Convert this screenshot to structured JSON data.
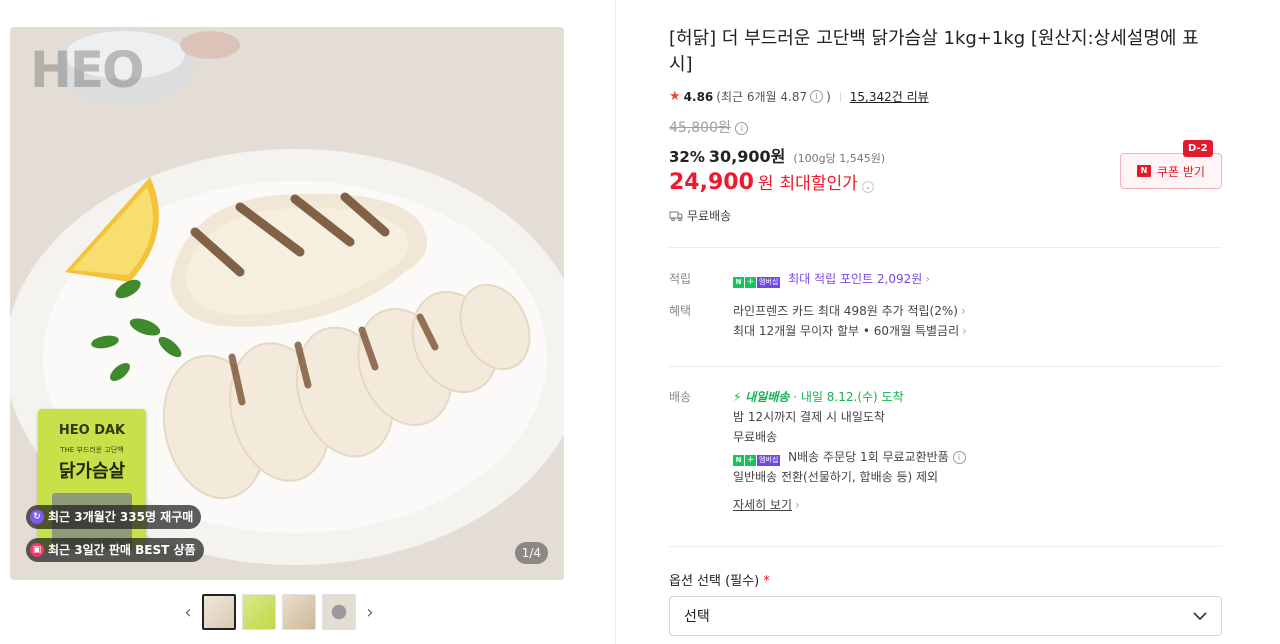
{
  "gallery": {
    "watermark": "HEO",
    "package": {
      "brand": "HEO DAK",
      "subtitle": "THE 부드러운 고단백",
      "name": "닭가슴살"
    },
    "badges": [
      {
        "icon": "repurchase-icon",
        "text": "최근 3개월간 335명 재구매",
        "color": "#7b5cf0"
      },
      {
        "icon": "gift-icon",
        "text": "최근 3일간 판매 BEST 상품",
        "color": "#f0386b"
      }
    ],
    "pager": "1/4",
    "thumbnails": [
      "썸네일 1",
      "썸네일 2",
      "썸네일 3",
      "썸네일 4"
    ]
  },
  "product": {
    "title": "[허닭] 더 부드러운 고단백 닭가슴살 1kg+1kg [원산지:상세설명에 표시]",
    "rating": "4.86",
    "recent_rating": "(최근 6개월 4.87",
    "recent_rating_close": ")",
    "reviews": "15,342건 리뷰",
    "original_price": "45,800원",
    "discount_pct": "32%",
    "sale_price": "30,900원",
    "unit_price": "(100g당 1,545원)",
    "max_price": "24,900",
    "max_won": "원",
    "max_label": "최대할인가",
    "shipping": "무료배송",
    "coupon_label": "쿠폰 받기",
    "coupon_dday": "D-2"
  },
  "points": {
    "label": "적립",
    "text": "최대 적립 포인트 2,092원"
  },
  "benefits": {
    "label": "혜택",
    "lines": [
      "라인프렌즈 카드 최대 498원 추가 적립(2%)",
      "최대 12개월 무이자 할부 • 60개월 특별금리"
    ]
  },
  "delivery": {
    "label": "배송",
    "tomorrow": "내일배송",
    "date": "· 내일 8.12.(수) 도착",
    "cutoff": "밤 12시까지 결제 시 내일도착",
    "free": "무료배송",
    "nshipping": "N배송 주문당 1회 무료교환반품",
    "exclude": "일반배송 전환(선물하기, 합배송 등) 제외",
    "more": "자세히 보기"
  },
  "options": {
    "title": "옵션 선택 (필수)",
    "required_mark": "*",
    "select_value": "선택"
  },
  "colors": {
    "accent_red": "#f0192d",
    "naver_green": "#19c35a",
    "membership_purple": "#7b47e6"
  }
}
